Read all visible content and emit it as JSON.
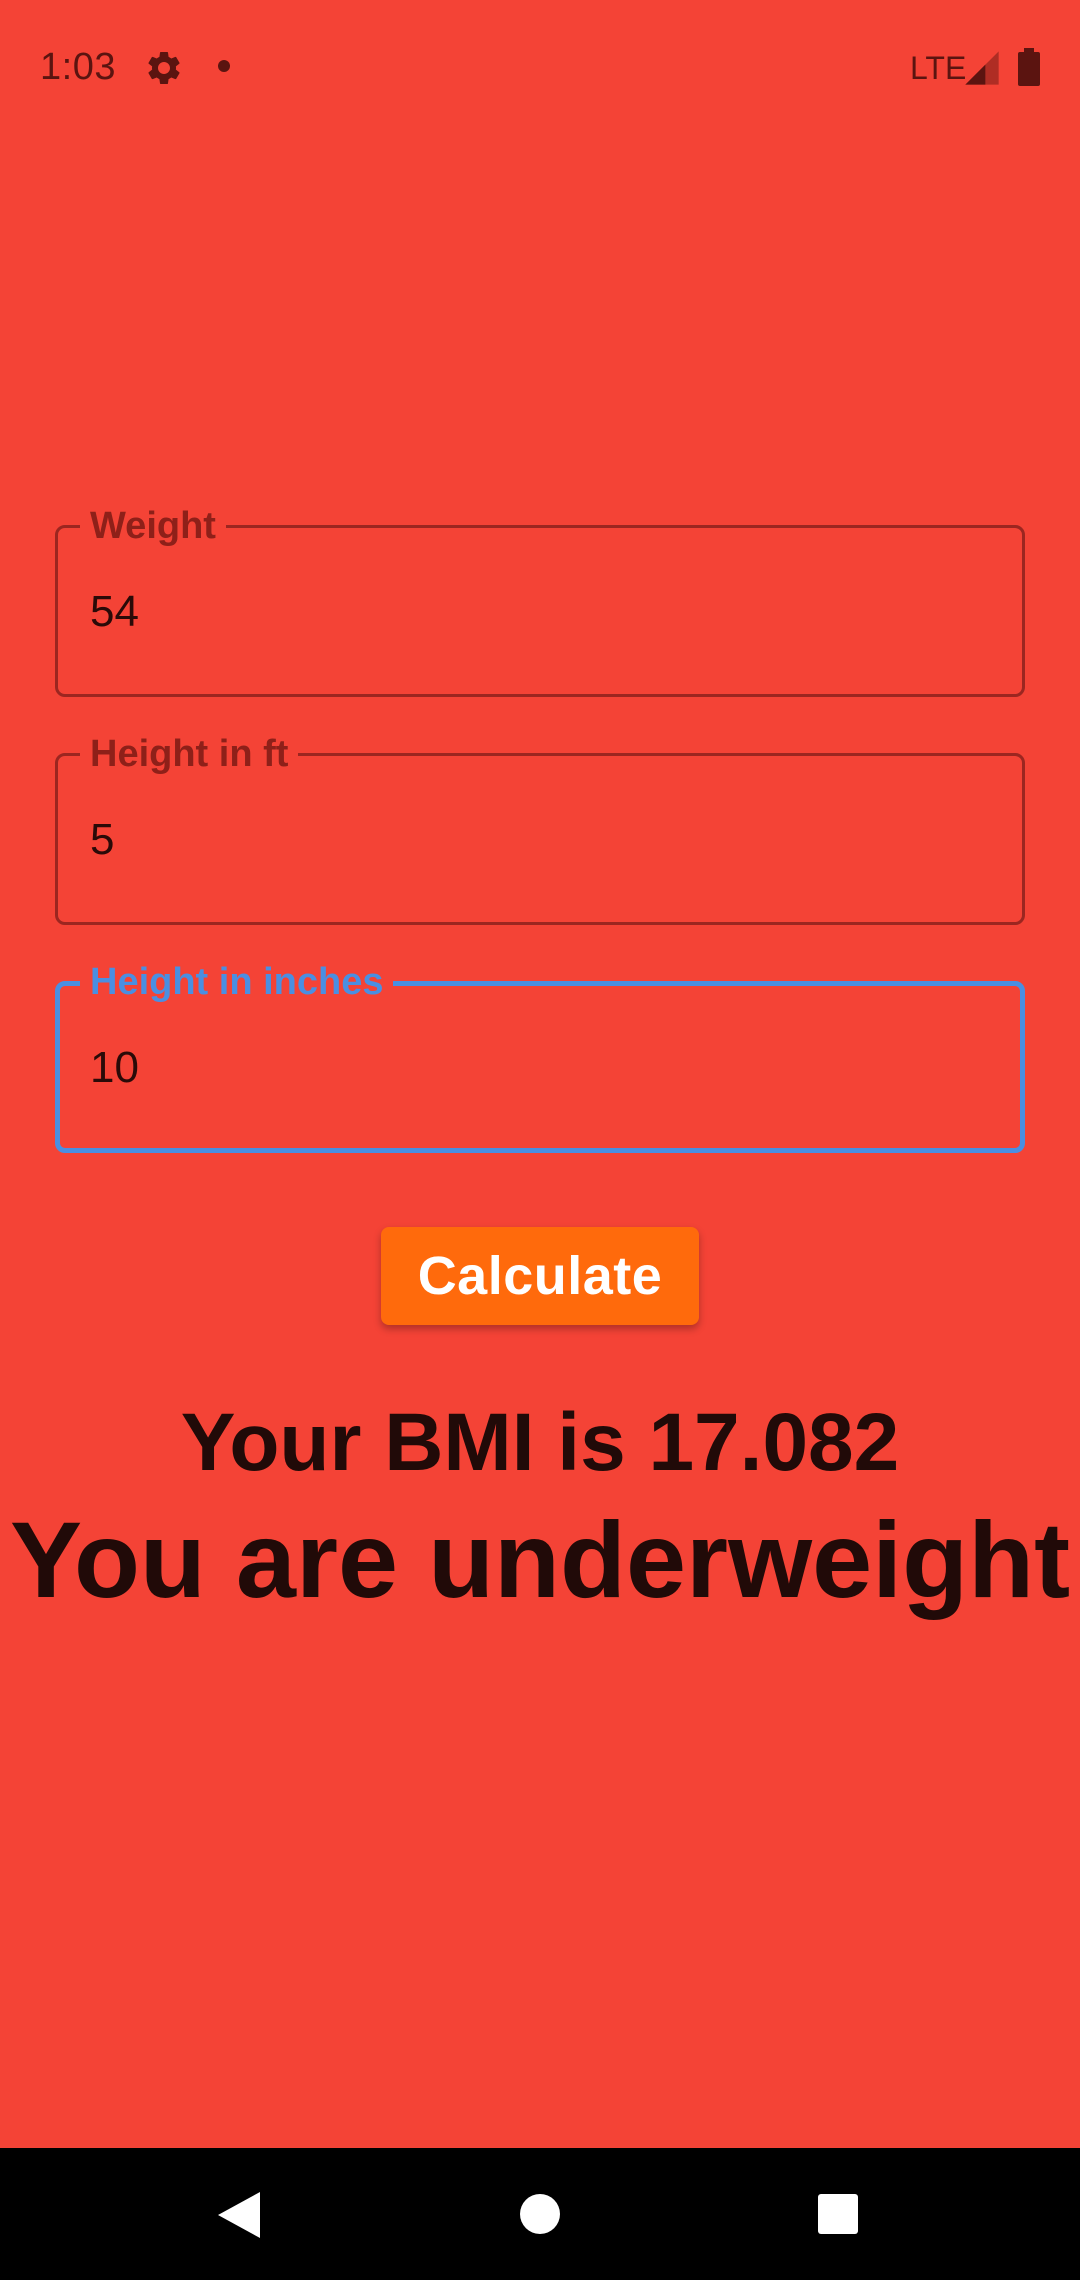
{
  "status_bar": {
    "time": "1:03",
    "network": "LTE",
    "icons": [
      "settings-gear-icon",
      "notification-dot-icon",
      "signal-icon",
      "battery-icon"
    ]
  },
  "form": {
    "weight": {
      "label": "Weight",
      "value": "54"
    },
    "height_ft": {
      "label": "Height in ft",
      "value": "5"
    },
    "height_in": {
      "label": "Height in inches",
      "value": "10",
      "focused": true
    }
  },
  "calculate_button": {
    "label": "Calculate"
  },
  "result": {
    "bmi_text": "Your BMI is 17.082",
    "category_text": "You are underweight"
  },
  "nav_bar": {
    "icons": [
      "back-icon",
      "home-icon",
      "recents-icon"
    ]
  },
  "colors": {
    "background": "#f44336",
    "focus_accent": "#4a8fe2",
    "button": "#ff6a0c",
    "text_dark": "#210a08"
  }
}
